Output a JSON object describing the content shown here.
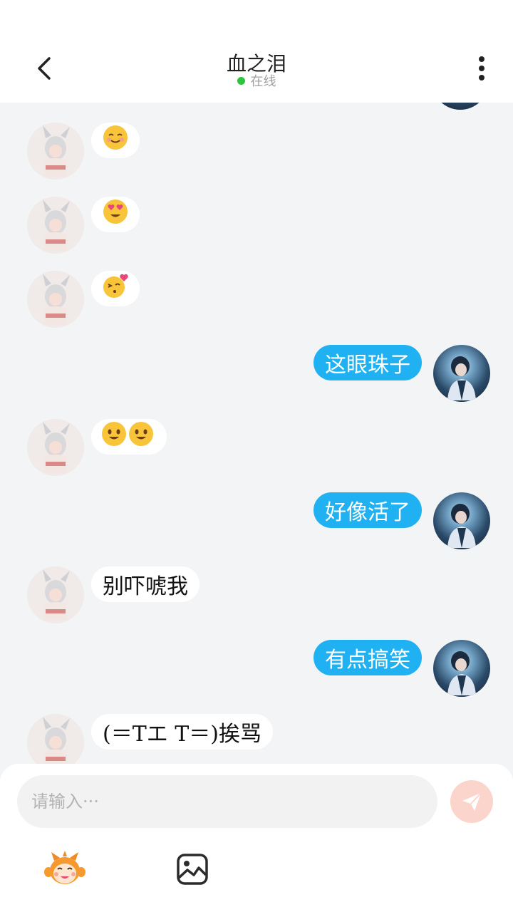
{
  "header": {
    "title": "血之泪",
    "status": "在线"
  },
  "messages": [
    {
      "side": "left",
      "type": "emoji",
      "emojis": [
        "smiling-face-emoji"
      ]
    },
    {
      "side": "left",
      "type": "emoji",
      "emojis": [
        "heart-eyes-emoji"
      ]
    },
    {
      "side": "left",
      "type": "emoji",
      "emojis": [
        "kissing-heart-emoji"
      ]
    },
    {
      "side": "right",
      "type": "text",
      "text": "这眼珠子"
    },
    {
      "side": "left",
      "type": "emoji",
      "emojis": [
        "grinning-face-emoji",
        "grinning-face-emoji"
      ]
    },
    {
      "side": "right",
      "type": "text",
      "text": "好像活了"
    },
    {
      "side": "left",
      "type": "text",
      "text": "别吓唬我"
    },
    {
      "side": "right",
      "type": "text",
      "text": "有点搞笑"
    },
    {
      "side": "left",
      "type": "text",
      "text": "(＝Tエ T＝)挨骂"
    }
  ],
  "input": {
    "placeholder": "请输入···"
  },
  "colors": {
    "accent": "#1fb1f2",
    "online": "#2cc43d",
    "send_button": "#fbd5cc",
    "background": "#f2f4f5"
  },
  "icons": {
    "back": "chevron-left-icon",
    "more": "more-vertical-icon",
    "send": "paper-plane-icon",
    "emoji": "monkey-emoji-icon",
    "image": "image-icon"
  }
}
